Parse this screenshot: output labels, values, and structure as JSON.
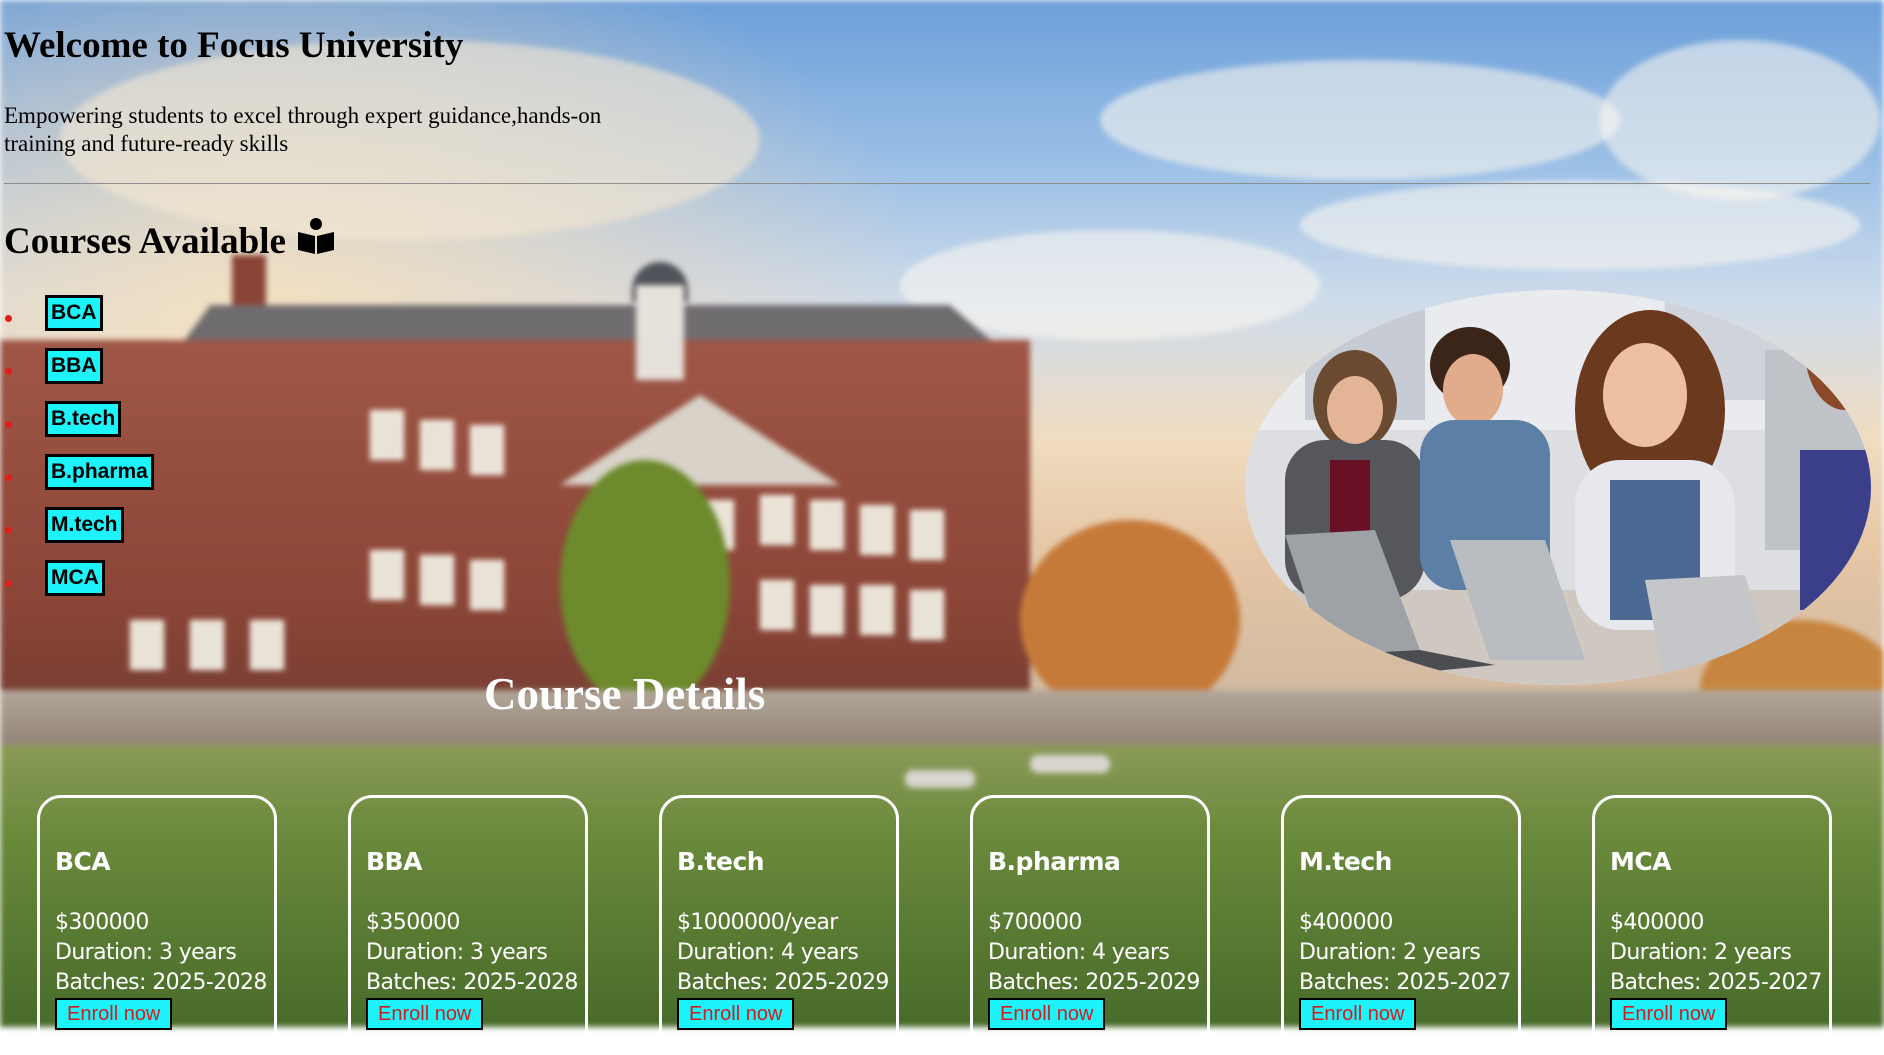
{
  "hero": {
    "title": "Welcome to Focus University",
    "subtitle": "Empowering students to excel through expert guidance,hands-on training and future-ready skills"
  },
  "courses": {
    "heading": "Courses Available",
    "heading_icon": "open-book-reader-icon",
    "items": [
      {
        "label": "BCA"
      },
      {
        "label": "BBA"
      },
      {
        "label": "B.tech"
      },
      {
        "label": "B.pharma"
      },
      {
        "label": "M.tech"
      },
      {
        "label": "MCA"
      }
    ]
  },
  "photo": {
    "description": "students-with-laptops-photo"
  },
  "details": {
    "heading": "Course Details",
    "cards": [
      {
        "name": "BCA",
        "price": "$300000",
        "duration": "Duration: 3 years",
        "batches": "Batches: 2025-2028",
        "button": "Enroll now"
      },
      {
        "name": "BBA",
        "price": "$350000",
        "duration": "Duration: 3 years",
        "batches": "Batches: 2025-2028",
        "button": "Enroll now"
      },
      {
        "name": "B.tech",
        "price": "$1000000/year",
        "duration": "Duration: 4 years",
        "batches": "Batches: 2025-2029",
        "button": "Enroll now"
      },
      {
        "name": "B.pharma",
        "price": "$700000",
        "duration": "Duration: 4 years",
        "batches": "Batches: 2025-2029",
        "button": "Enroll now"
      },
      {
        "name": "M.tech",
        "price": "$400000",
        "duration": "Duration: 2 years",
        "batches": "Batches: 2025-2027",
        "button": "Enroll now"
      },
      {
        "name": "MCA",
        "price": "$400000",
        "duration": "Duration: 2 years",
        "batches": "Batches: 2025-2027",
        "button": "Enroll now"
      }
    ]
  },
  "colors": {
    "chip_bg": "#1cf3fb",
    "bullet": "#e21b1b",
    "enroll_text": "#d21c1c",
    "card_border": "#ffffff"
  }
}
